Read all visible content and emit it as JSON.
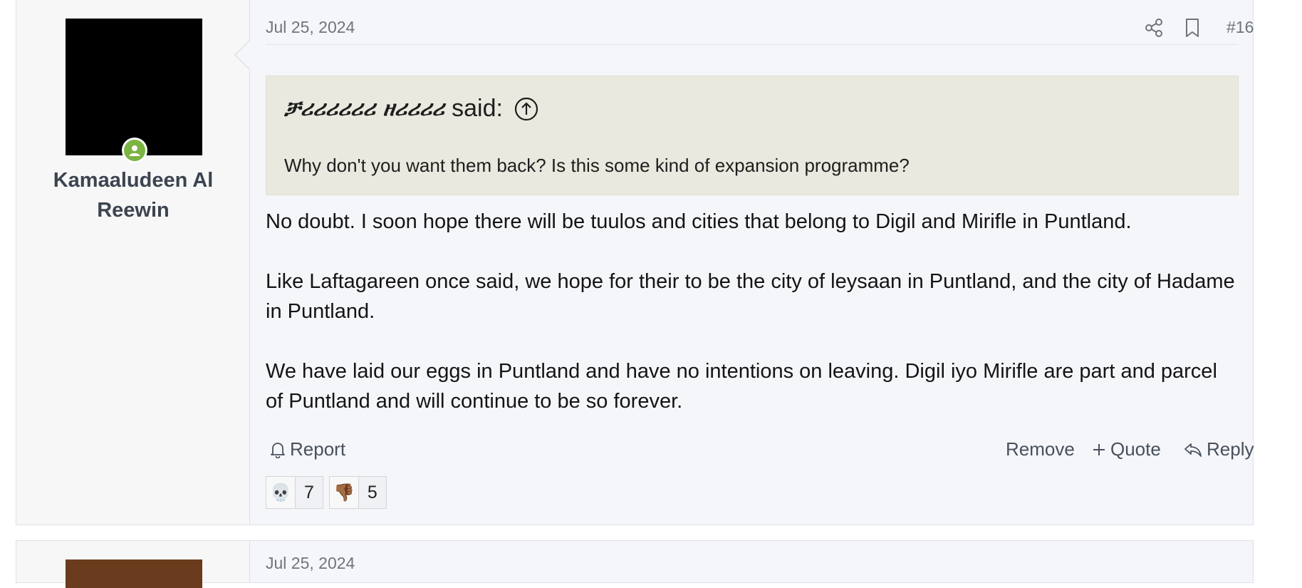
{
  "post": {
    "username": "Kamaaludeen Al Reewin",
    "date": "Jul 25, 2024",
    "post_number": "#16",
    "quote": {
      "author": "ቻሪሪሪሪሪሪ ዘሪሪሪሪ",
      "said_label": "said:",
      "text": "Why don't you want them back? Is this some kind of expansion programme?"
    },
    "body": [
      "No doubt. I soon hope there will be tuulos and cities that belong to Digil and Mirifle in Puntland.",
      "Like Laftagareen once said, we hope for their to be the city of leysaan in Puntland, and the city of Hadame in Puntland.",
      "We have laid our eggs in Puntland and have no intentions on leaving. Digil iyo Mirifle are part and parcel of Puntland and will continue to be so forever."
    ],
    "actions": {
      "report": "Report",
      "remove": "Remove",
      "quote": "Quote",
      "reply": "Reply"
    },
    "reactions": [
      {
        "emoji": "💀",
        "icon": "skull-icon",
        "count": "7"
      },
      {
        "emoji": "👎🏾",
        "icon": "thumbs-down-icon",
        "count": "5"
      }
    ]
  },
  "next_post": {
    "date": "Jul 25, 2024"
  },
  "colors": {
    "online": "#7cb342",
    "quote_bg": "#eae9df",
    "post_bg": "#f5f6fa"
  }
}
